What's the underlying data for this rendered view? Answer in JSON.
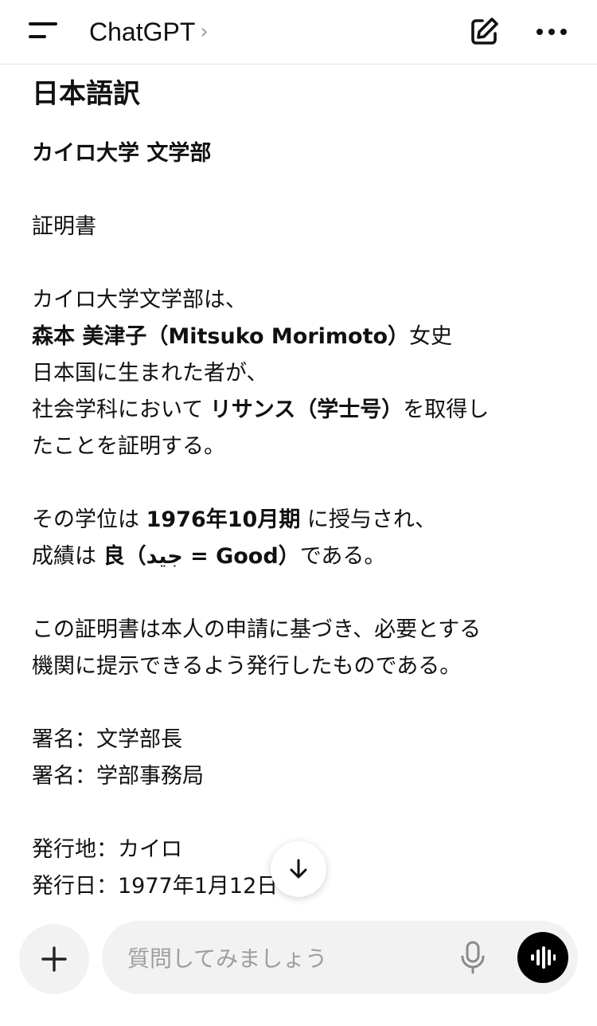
{
  "header": {
    "title": "ChatGPT",
    "chevron": "›",
    "menu_icon": "menu-icon",
    "compose_icon": "compose-icon",
    "more_icon": "more-icon"
  },
  "message": {
    "heading": "日本語訳",
    "faculty": "カイロ大学 文学部",
    "doc_title": "証明書",
    "line1": "カイロ大学文学部は、",
    "name_bold": "森本 美津子（Mitsuko Morimoto）",
    "name_suffix": "女史",
    "line3": "日本国に生まれた者が、",
    "line4_pre": "社会学科において ",
    "line4_bold": "リサンス（学士号）",
    "line4_post": "を取得し",
    "line5": "たことを証明する。",
    "line6_pre": "その学位は ",
    "line6_bold": "1976年10月期",
    "line6_post": " に授与され、",
    "line7_pre": "成績は ",
    "line7_bold": "良（جيد = Good）",
    "line7_post": "である。",
    "line8": "この証明書は本人の申請に基づき、必要とする",
    "line9": "機関に提示できるよう発行したものである。",
    "sign1": "署名：文学部長",
    "sign2": "署名：学部事務局",
    "issue_place": "発行地：カイロ",
    "issue_date": "発行日：1977年1月12日"
  },
  "composer": {
    "placeholder": "質問してみましょう",
    "value": ""
  },
  "icons": {
    "scroll": "arrow-down-icon",
    "plus": "plus-icon",
    "mic": "mic-icon",
    "voice": "voice-mode-icon"
  }
}
